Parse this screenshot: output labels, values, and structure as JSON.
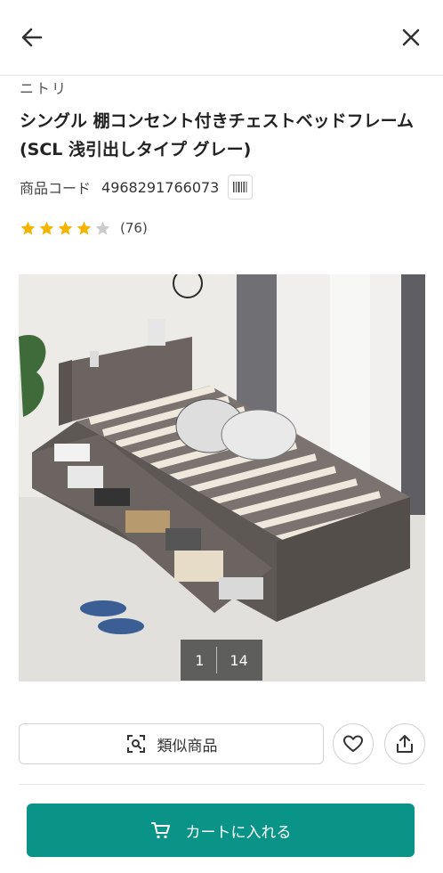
{
  "header": {
    "back_icon": "arrow-left-icon",
    "close_icon": "close-icon"
  },
  "product": {
    "brand": "ニトリ",
    "title": "シングル 棚コンセント付きチェストベッドフレーム (SCL 浅引出しタイプ グレー)",
    "code_label": "商品コード",
    "code_value": "4968291766073",
    "rating": {
      "stars": 4,
      "max": 5,
      "count_text": "(76)"
    }
  },
  "gallery": {
    "current": "1",
    "total": "14"
  },
  "actions": {
    "similar_label": "類似商品",
    "favorite_icon": "heart-icon",
    "share_icon": "share-icon",
    "cart_label": "カートに入れる"
  },
  "colors": {
    "accent": "#0a9487",
    "star": "#f5b400",
    "star_empty": "#cccccc"
  }
}
